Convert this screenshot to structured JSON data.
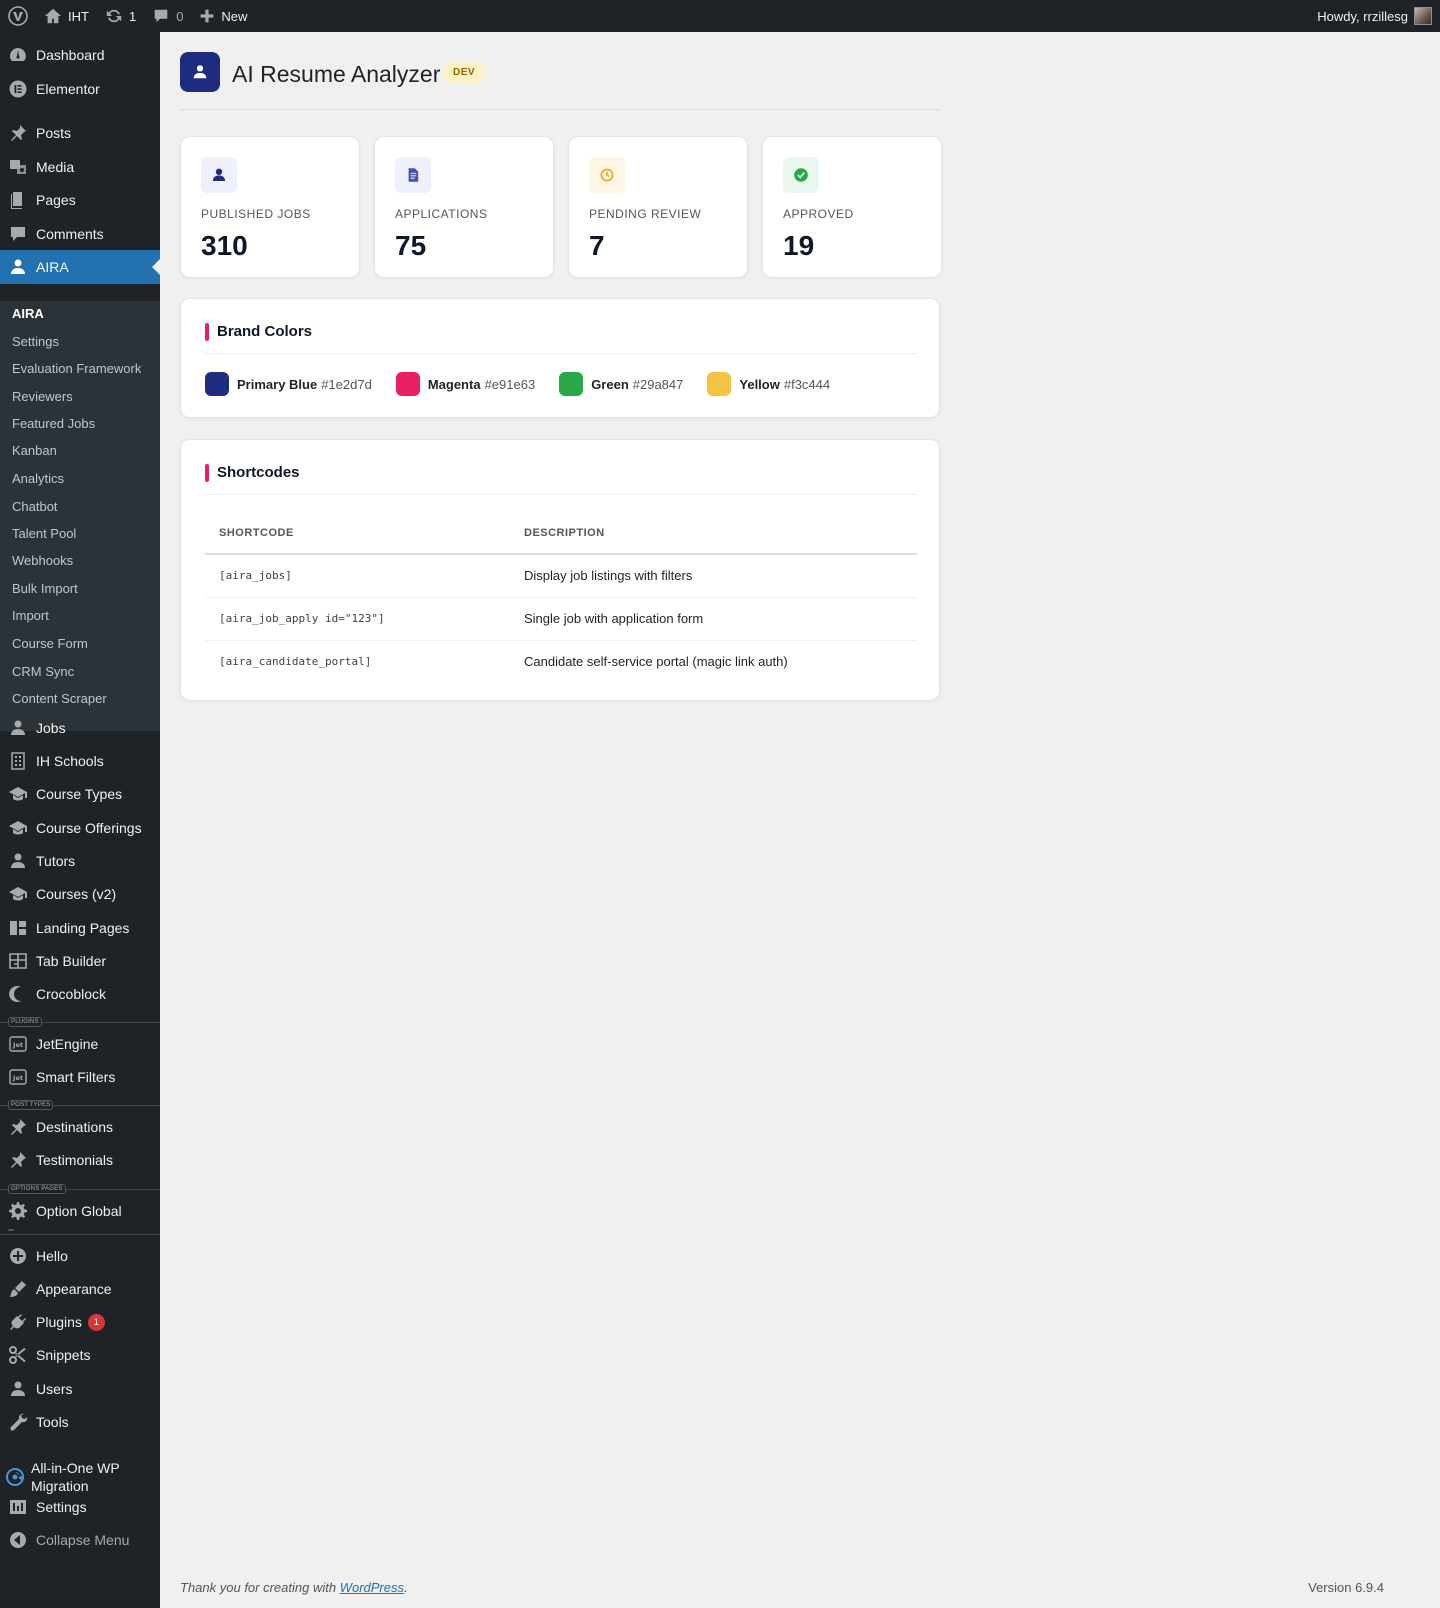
{
  "admin_bar": {
    "site_name": "IHT",
    "updates_count": "1",
    "comments_count": "0",
    "new_label": "New",
    "howdy": "Howdy, rrzillesg"
  },
  "sidebar": {
    "top_items": [
      {
        "label": "Dashboard",
        "icon": "dashboard-icon"
      },
      {
        "label": "Elementor",
        "icon": "elementor-icon"
      },
      {
        "label": "Posts",
        "icon": "pin-icon"
      },
      {
        "label": "Media",
        "icon": "media-icon"
      },
      {
        "label": "Pages",
        "icon": "pages-icon"
      },
      {
        "label": "Comments",
        "icon": "comment-icon"
      },
      {
        "label": "AIRA",
        "icon": "user-icon"
      }
    ],
    "aira_submenu": [
      "AIRA",
      "Settings",
      "Evaluation Framework",
      "Reviewers",
      "Featured Jobs",
      "Kanban",
      "Analytics",
      "Chatbot",
      "Talent Pool",
      "Webhooks",
      "Bulk Import",
      "Import",
      "Course Form",
      "CRM Sync",
      "Content Scraper"
    ],
    "cpt_items": [
      {
        "label": "Jobs",
        "icon": "user-icon"
      },
      {
        "label": "IH Schools",
        "icon": "building-icon"
      },
      {
        "label": "Course Types",
        "icon": "graduation-cap-icon"
      },
      {
        "label": "Course Offerings",
        "icon": "graduation-cap-icon"
      },
      {
        "label": "Tutors",
        "icon": "user-icon"
      },
      {
        "label": "Courses (v2)",
        "icon": "graduation-cap-icon"
      },
      {
        "label": "Landing Pages",
        "icon": "layout-icon"
      },
      {
        "label": "Tab Builder",
        "icon": "table-icon"
      },
      {
        "label": "Crocoblock",
        "icon": "crocoblock-icon"
      }
    ],
    "plugins_label": "PLUGINS",
    "plugin_items": [
      {
        "label": "JetEngine",
        "icon": "jet-icon"
      },
      {
        "label": "Smart Filters",
        "icon": "jet-icon"
      }
    ],
    "post_types_label": "POST TYPES",
    "post_type_items": [
      {
        "label": "Destinations",
        "icon": "pin-icon"
      },
      {
        "label": "Testimonials",
        "icon": "pin-icon"
      }
    ],
    "options_label": "OPTIONS PAGES",
    "option_items": [
      {
        "label": "Option Global",
        "icon": "gear-icon"
      }
    ],
    "bottom_items": [
      {
        "label": "Hello",
        "icon": "plus-circle-icon"
      },
      {
        "label": "Appearance",
        "icon": "brush-icon"
      },
      {
        "label": "Plugins",
        "icon": "plugin-icon",
        "badge": "1"
      },
      {
        "label": "Snippets",
        "icon": "scissors-icon"
      },
      {
        "label": "Users",
        "icon": "user-icon"
      },
      {
        "label": "Tools",
        "icon": "wrench-icon"
      },
      {
        "label": "All-in-One WP Migration",
        "icon": "migration-icon"
      },
      {
        "label": "Settings",
        "icon": "settings-icon"
      }
    ],
    "collapse_label": "Collapse Menu"
  },
  "page": {
    "title": "AI Resume Analyzer",
    "badge": "DEV"
  },
  "stats": [
    {
      "label": "PUBLISHED JOBS",
      "value": "310",
      "icon": "user-icon",
      "bg": "#eef0fb",
      "fg": "#1e2d7d"
    },
    {
      "label": "APPLICATIONS",
      "value": "75",
      "icon": "document-icon",
      "bg": "#eef0fb",
      "fg": "#3f51b5"
    },
    {
      "label": "PENDING REVIEW",
      "value": "7",
      "icon": "clock-icon",
      "bg": "#fff7e6",
      "fg": "#f0a020"
    },
    {
      "label": "APPROVED",
      "value": "19",
      "icon": "check-circle-icon",
      "bg": "#e9f7ee",
      "fg": "#29a847"
    }
  ],
  "brand_colors": {
    "title": "Brand Colors",
    "items": [
      {
        "name": "Primary Blue",
        "hex": "#1e2d7d"
      },
      {
        "name": "Magenta",
        "hex": "#e91e63"
      },
      {
        "name": "Green",
        "hex": "#29a847"
      },
      {
        "name": "Yellow",
        "hex": "#f3c444"
      }
    ]
  },
  "shortcodes": {
    "title": "Shortcodes",
    "headers": [
      "SHORTCODE",
      "DESCRIPTION"
    ],
    "rows": [
      [
        "[aira_jobs]",
        "Display job listings with filters"
      ],
      [
        "[aira_job_apply id=\"123\"]",
        "Single job with application form"
      ],
      [
        "[aira_candidate_portal]",
        "Candidate self-service portal (magic link auth)"
      ]
    ]
  },
  "footer": {
    "thanks_prefix": "Thank you for creating with ",
    "wordpress_link": "WordPress",
    "thanks_suffix": ".",
    "version": "Version 6.9.4"
  }
}
